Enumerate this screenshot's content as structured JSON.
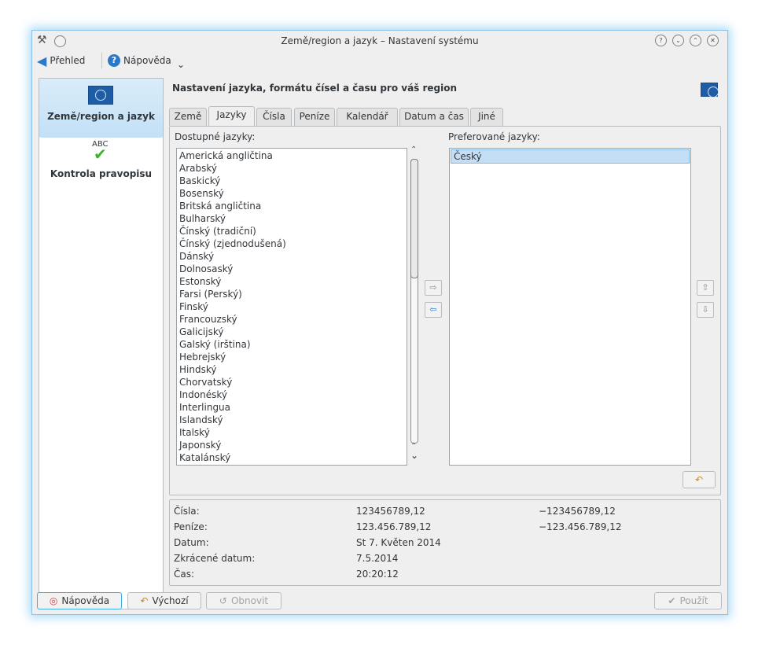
{
  "window": {
    "title": "Země/region a jazyk – Nastavení systému",
    "title_buttons": [
      "?",
      "⌄",
      "⌃",
      "✕"
    ]
  },
  "toolbar": {
    "overview_label": "Přehled",
    "help_label": "Nápověda",
    "dropdown_glyph": "⌄"
  },
  "sidebar": {
    "items": [
      {
        "label": "Země/region a jazyk",
        "selected": true,
        "icon": "un-flag-icon"
      },
      {
        "label": "Kontrola pravopisu",
        "selected": false,
        "icon": "spellcheck-abc-icon"
      }
    ],
    "abc_text": "ABC"
  },
  "main": {
    "heading": "Nastavení jazyka, formátu čísel a času pro váš region",
    "tabs": [
      {
        "label": "Země",
        "active": false
      },
      {
        "label": "Jazyky",
        "active": true
      },
      {
        "label": "Čísla",
        "active": false
      },
      {
        "label": "Peníze",
        "active": false
      },
      {
        "label": "Kalendář",
        "active": false
      },
      {
        "label": "Datum a čas",
        "active": false
      },
      {
        "label": "Jiné",
        "active": false
      }
    ],
    "available_label": "Dostupné jazyky:",
    "preferred_label": "Preferované jazyky:",
    "available_languages": [
      "Americká angličtina",
      "Arabský",
      "Baskický",
      "Bosenský",
      "Britská angličtina",
      "Bulharský",
      "Čínský (tradiční)",
      "Čínský (zjednodušená)",
      "Dánský",
      "Dolnosaský",
      "Estonský",
      "Farsi (Perský)",
      "Finský",
      "Francouzský",
      "Galicijský",
      "Galský (irština)",
      "Hebrejský",
      "Hindský",
      "Chorvatský",
      "Indonéský",
      "Interlingua",
      "Islandský",
      "Italský",
      "Japonský",
      "Katalánský"
    ],
    "preferred_languages": [
      "Český"
    ],
    "arrows": {
      "add": "⇨",
      "remove": "⇦",
      "up": "⇧",
      "down": "⇩"
    },
    "scroll_up_glyph": "⌃",
    "scroll_down_glyph": "⌄"
  },
  "preview": {
    "rows": [
      {
        "label": "Čísla:",
        "value1": "123456789,12",
        "value2": "−123456789,12"
      },
      {
        "label": "Peníze:",
        "value1": "123.456.789,12",
        "value2": "−123.456.789,12"
      },
      {
        "label": "Datum:",
        "value1": "St 7. Květen 2014",
        "value2": ""
      },
      {
        "label": "Zkrácené datum:",
        "value1": "7.5.2014",
        "value2": ""
      },
      {
        "label": "Čas:",
        "value1": "20:20:12",
        "value2": ""
      }
    ]
  },
  "buttons": {
    "help": "Nápověda",
    "defaults": "Výchozí",
    "reset": "Obnovit",
    "apply": "Použít"
  },
  "colors": {
    "accent": "#3daee9",
    "selection": "#c4dff5",
    "background": "#efefef"
  }
}
